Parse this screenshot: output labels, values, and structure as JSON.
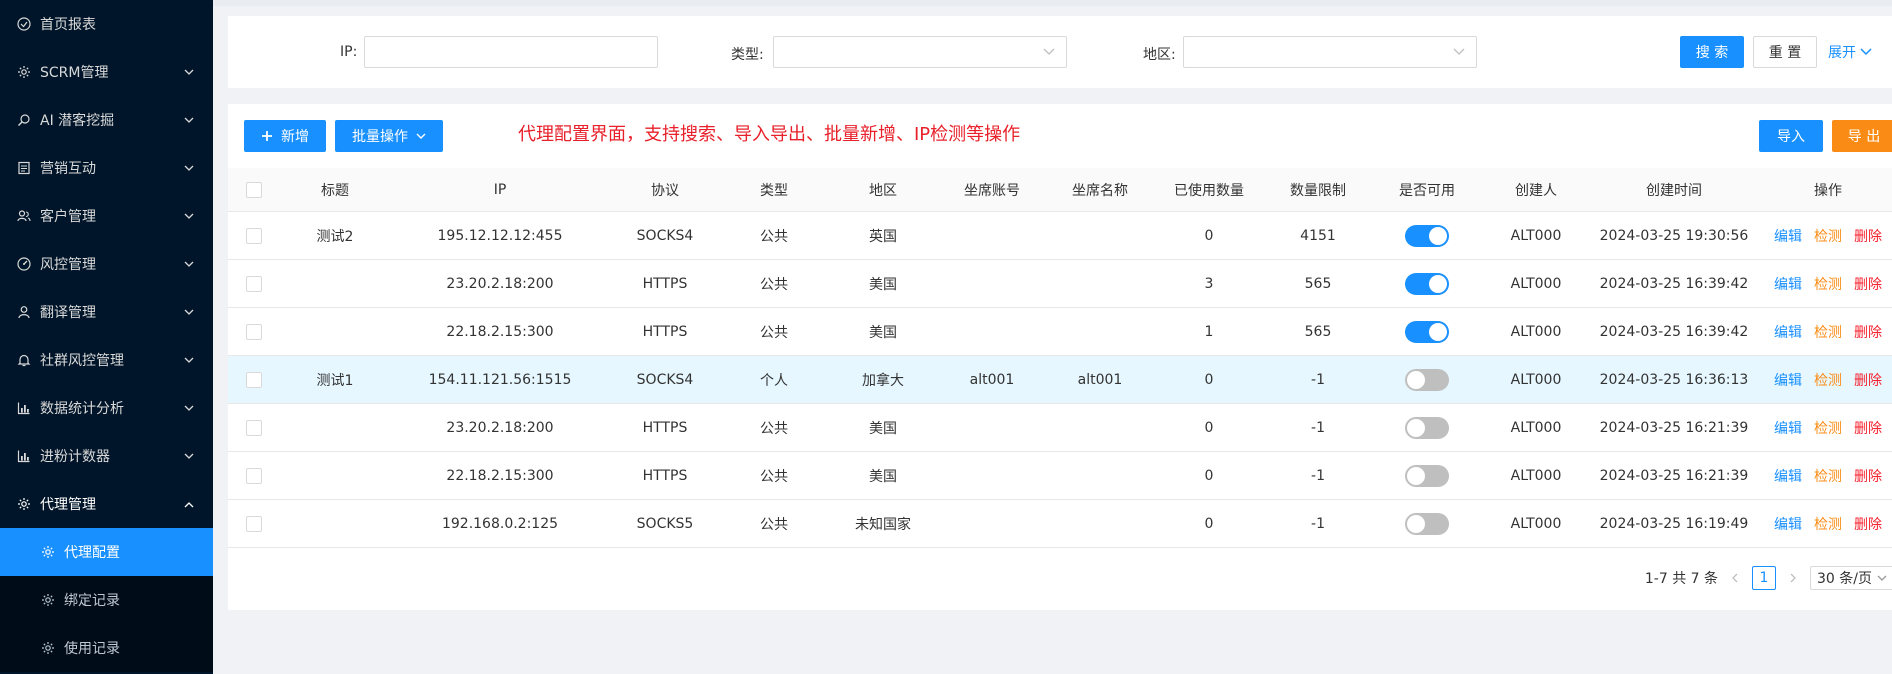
{
  "sidebar": {
    "items": [
      {
        "label": "首页报表",
        "icon": "dashboard-icon",
        "has_arrow": false
      },
      {
        "label": "SCRM管理",
        "icon": "gear-icon",
        "has_arrow": true
      },
      {
        "label": "AI 潜客挖掘",
        "icon": "search-icon",
        "has_arrow": true
      },
      {
        "label": "营销互动",
        "icon": "document-icon",
        "has_arrow": true
      },
      {
        "label": "客户管理",
        "icon": "users-icon",
        "has_arrow": true
      },
      {
        "label": "风控管理",
        "icon": "gauge-icon",
        "has_arrow": true
      },
      {
        "label": "翻译管理",
        "icon": "user-icon",
        "has_arrow": true
      },
      {
        "label": "社群风控管理",
        "icon": "bell-icon",
        "has_arrow": true
      },
      {
        "label": "数据统计分析",
        "icon": "bar-chart-icon",
        "has_arrow": true
      },
      {
        "label": "进粉计数器",
        "icon": "bar-chart-icon",
        "has_arrow": true
      },
      {
        "label": "代理管理",
        "icon": "gear-icon",
        "has_arrow": true,
        "open": true
      }
    ],
    "subitems": [
      {
        "label": "代理配置",
        "active": true
      },
      {
        "label": "绑定记录",
        "active": false
      },
      {
        "label": "使用记录",
        "active": false
      }
    ]
  },
  "search": {
    "ip_label": "IP:",
    "ip_value": "",
    "type_label": "类型:",
    "type_value": "",
    "region_label": "地区:",
    "region_value": "",
    "search_btn": "搜 索",
    "reset_btn": "重 置",
    "expand_btn": "展开"
  },
  "toolbar": {
    "add_btn": "新增",
    "batch_btn": "批量操作",
    "notice": "代理配置界面，支持搜索、导入导出、批量新增、IP检测等操作",
    "import_btn": "导入",
    "export_btn": "导 出"
  },
  "table": {
    "headers": [
      "标题",
      "IP",
      "协议",
      "类型",
      "地区",
      "坐席账号",
      "坐席名称",
      "已使用数量",
      "数量限制",
      "是否可用",
      "创建人",
      "创建时间",
      "操作"
    ],
    "actions": {
      "edit": "编辑",
      "check": "检测",
      "delete": "删除"
    },
    "rows": [
      {
        "title": "测试2",
        "ip": "195.12.12.12:455",
        "protocol": "SOCKS4",
        "type": "公共",
        "region": "英国",
        "seat_account": "",
        "seat_name": "",
        "used": "0",
        "limit": "4151",
        "enabled": true,
        "creator": "ALT000",
        "created": "2024-03-25 19:30:56"
      },
      {
        "title": "",
        "ip": "23.20.2.18:200",
        "protocol": "HTTPS",
        "type": "公共",
        "region": "美国",
        "seat_account": "",
        "seat_name": "",
        "used": "3",
        "limit": "565",
        "enabled": true,
        "creator": "ALT000",
        "created": "2024-03-25 16:39:42"
      },
      {
        "title": "",
        "ip": "22.18.2.15:300",
        "protocol": "HTTPS",
        "type": "公共",
        "region": "美国",
        "seat_account": "",
        "seat_name": "",
        "used": "1",
        "limit": "565",
        "enabled": true,
        "creator": "ALT000",
        "created": "2024-03-25 16:39:42"
      },
      {
        "title": "测试1",
        "ip": "154.11.121.56:1515",
        "protocol": "SOCKS4",
        "type": "个人",
        "region": "加拿大",
        "seat_account": "alt001",
        "seat_name": "alt001",
        "used": "0",
        "limit": "-1",
        "enabled": false,
        "creator": "ALT000",
        "created": "2024-03-25 16:36:13",
        "highlight": true
      },
      {
        "title": "",
        "ip": "23.20.2.18:200",
        "protocol": "HTTPS",
        "type": "公共",
        "region": "美国",
        "seat_account": "",
        "seat_name": "",
        "used": "0",
        "limit": "-1",
        "enabled": false,
        "creator": "ALT000",
        "created": "2024-03-25 16:21:39"
      },
      {
        "title": "",
        "ip": "22.18.2.15:300",
        "protocol": "HTTPS",
        "type": "公共",
        "region": "美国",
        "seat_account": "",
        "seat_name": "",
        "used": "0",
        "limit": "-1",
        "enabled": false,
        "creator": "ALT000",
        "created": "2024-03-25 16:21:39"
      },
      {
        "title": "",
        "ip": "192.168.0.2:125",
        "protocol": "SOCKS5",
        "type": "公共",
        "region": "未知国家",
        "seat_account": "",
        "seat_name": "",
        "used": "0",
        "limit": "-1",
        "enabled": false,
        "creator": "ALT000",
        "created": "2024-03-25 16:19:49"
      }
    ]
  },
  "pagination": {
    "summary": "1-7 共 7 条",
    "current": "1",
    "page_size": "30 条/页"
  },
  "colors": {
    "sidebar_bg": "#001529",
    "primary": "#1890ff",
    "warning": "#fa8c16",
    "danger": "#f5222d",
    "notice": "#e8202a"
  }
}
